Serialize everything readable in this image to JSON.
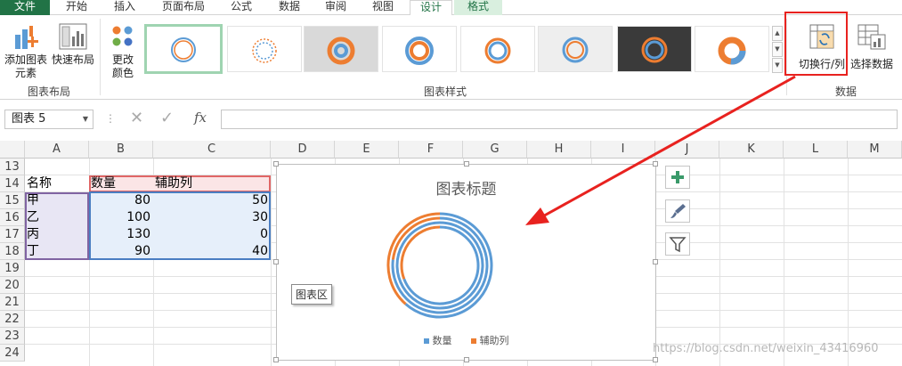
{
  "tabs": [
    "文件",
    "开始",
    "插入",
    "页面布局",
    "公式",
    "数据",
    "审阅",
    "视图",
    "设计",
    "格式"
  ],
  "ribbon": {
    "add_element": [
      "添加图表",
      "元素"
    ],
    "quick_layout": "快速布局",
    "change_colors": [
      "更改",
      "颜色"
    ],
    "switch_row_col": "切换行/列",
    "select_data": "选择数据",
    "group_chart_layout": "图表布局",
    "group_chart_styles": "图表样式",
    "group_data": "数据"
  },
  "formula_bar": {
    "name_box": "图表 5",
    "fx": "fx",
    "value": ""
  },
  "columns": [
    "A",
    "B",
    "C",
    "D",
    "E",
    "F",
    "G",
    "H",
    "I",
    "J",
    "K",
    "L",
    "M"
  ],
  "rows": [
    "13",
    "14",
    "15",
    "16",
    "17",
    "18",
    "19",
    "20",
    "21",
    "22",
    "23",
    "24"
  ],
  "table": {
    "header": [
      "名称",
      "数量",
      "辅助列"
    ],
    "body": [
      [
        "甲",
        "80",
        "50"
      ],
      [
        "乙",
        "100",
        "30"
      ],
      [
        "丙",
        "130",
        "0"
      ],
      [
        "丁",
        "90",
        "40"
      ]
    ]
  },
  "chart": {
    "title": "图表标题",
    "legend": [
      "数量",
      "辅助列"
    ],
    "series_colors": [
      "#5b9bd5",
      "#ed7d31"
    ],
    "tooltip": "图表区"
  },
  "chart_data": {
    "type": "doughnut",
    "title": "图表标题",
    "categories": [
      "数量",
      "辅助列"
    ],
    "series": [
      {
        "name": "甲",
        "values": [
          80,
          50
        ]
      },
      {
        "name": "乙",
        "values": [
          100,
          30
        ]
      },
      {
        "name": "丙",
        "values": [
          130,
          0
        ]
      },
      {
        "name": "丁",
        "values": [
          90,
          40
        ]
      }
    ],
    "legend": "bottom"
  },
  "icons": {
    "plus": "chart-elements-icon",
    "brush": "chart-styles-icon",
    "filter": "chart-filter-icon"
  },
  "watermark": "https://blog.csdn.net/weixin_43416960"
}
